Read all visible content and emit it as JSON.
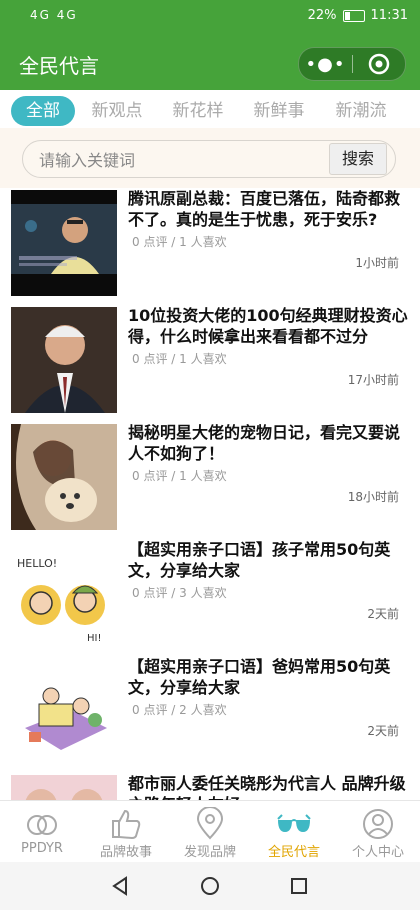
{
  "status": {
    "left": "4G 4G",
    "battery": "22%",
    "time": "11:31"
  },
  "header": {
    "title": "全民代言",
    "menu_icon": "more-dots-icon",
    "close_icon": "target-icon"
  },
  "tabs": [
    {
      "label": "全部",
      "active": true
    },
    {
      "label": "新观点",
      "active": false
    },
    {
      "label": "新花样",
      "active": false
    },
    {
      "label": "新鲜事",
      "active": false
    },
    {
      "label": "新潮流",
      "active": false
    }
  ],
  "search": {
    "placeholder": "请输入关键词",
    "button": "搜索"
  },
  "articles": [
    {
      "title": "腾讯原副总裁：百度已落伍，陆奇都救不了。真的是生于忧患，死于安乐?",
      "meta": "0 点评 / 1 人喜欢",
      "time": "1小时前"
    },
    {
      "title": "10位投资大佬的100句经典理财投资心得，什么时候拿出来看看都不过分",
      "meta": "0 点评 / 1 人喜欢",
      "time": "17小时前"
    },
    {
      "title": "揭秘明星大佬的宠物日记，看完又要说人不如狗了！",
      "meta": "0 点评 / 1 人喜欢",
      "time": "18小时前"
    },
    {
      "title": "【超实用亲子口语】孩子常用50句英文，分享给大家",
      "meta": "0 点评 / 3 人喜欢",
      "time": "2天前"
    },
    {
      "title": "【超实用亲子口语】爸妈常用50句英文，分享给大家",
      "meta": "0 点评 / 2 人喜欢",
      "time": "2天前"
    },
    {
      "title": "都市丽人委任关晓彤为代言人 品牌升级之路年轻人友好",
      "meta": "",
      "time": ""
    }
  ],
  "thumbs": {
    "hello": "HELLO!",
    "hi": "HI!"
  },
  "nav": [
    {
      "label": "PPDYR",
      "icon": "rings-icon",
      "active": false
    },
    {
      "label": "品牌故事",
      "icon": "thumbs-up-icon",
      "active": false
    },
    {
      "label": "发现品牌",
      "icon": "location-pin-icon",
      "active": false
    },
    {
      "label": "全民代言",
      "icon": "glasses-icon",
      "active": true
    },
    {
      "label": "个人中心",
      "icon": "user-icon",
      "active": false
    }
  ],
  "colors": {
    "brand_green": "#46a33a",
    "tab_active": "#3fb8c4",
    "nav_active": "#e0a400"
  }
}
